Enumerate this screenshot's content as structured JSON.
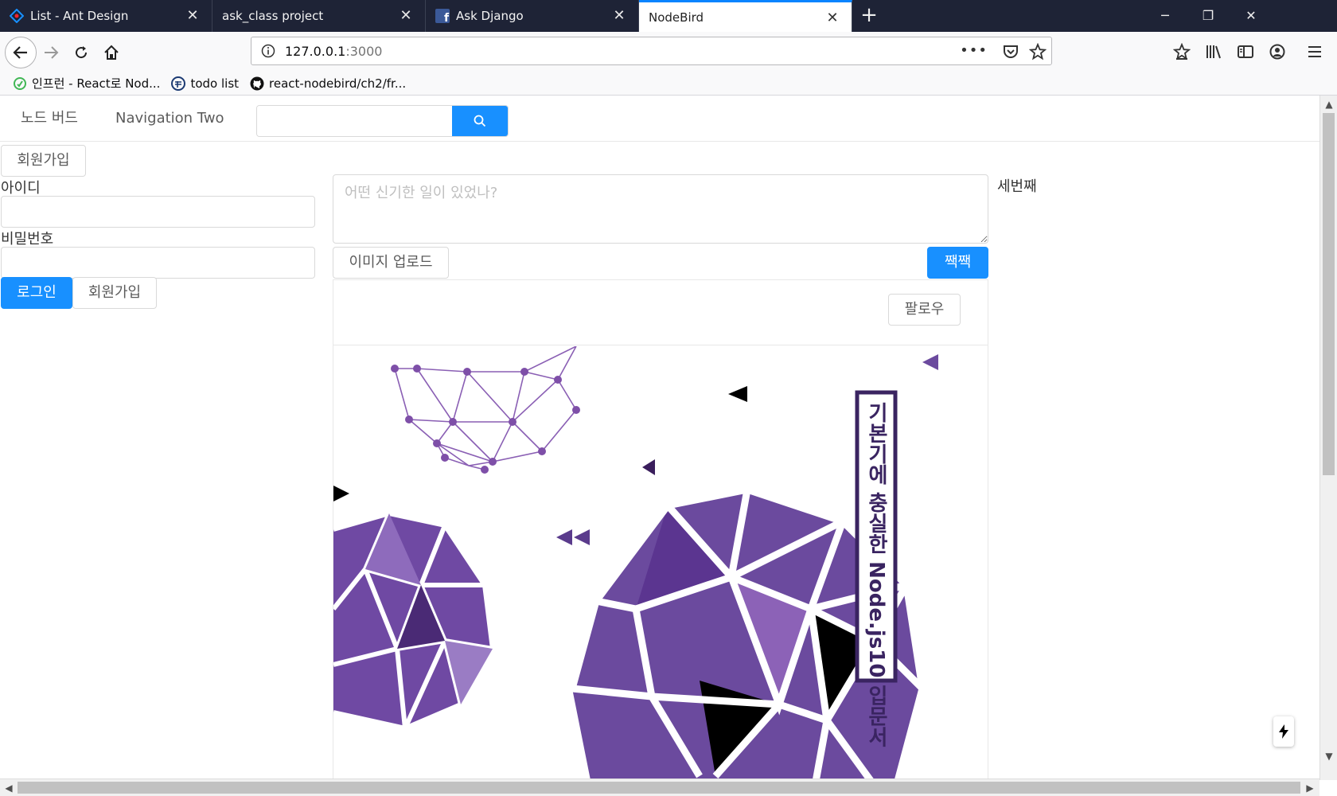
{
  "browser": {
    "tabs": [
      {
        "title": "List - Ant Design",
        "icon": "ant-design-logo-icon"
      },
      {
        "title": "ask_class project",
        "icon": "none"
      },
      {
        "title": "Ask Django",
        "icon": "facebook-icon"
      },
      {
        "title": "NodeBird",
        "icon": "none",
        "active": true
      }
    ],
    "url": {
      "host": "127.0.0.1",
      "port": ":3000"
    },
    "bookmarks": [
      {
        "label": "인프런 - React로 Nod...",
        "icon": "inflearn-icon"
      },
      {
        "label": "todo list",
        "icon": "todo-icon"
      },
      {
        "label": "react-nodebird/ch2/fr...",
        "icon": "github-icon"
      }
    ],
    "colors": {
      "tabbar": "#1e2336",
      "accent": "#0a84ff"
    }
  },
  "menu": {
    "items": [
      "노드 버드",
      "Navigation Two"
    ],
    "search_placeholder": ""
  },
  "left": {
    "signup_top": "회원가입",
    "id_label": "아이디",
    "password_label": "비밀번호",
    "login_button": "로그인",
    "signup_button": "회원가입"
  },
  "post_form": {
    "placeholder": "어떤 신기한 일이 있었나?",
    "upload_button": "이미지 업로드",
    "submit_button": "짹짹"
  },
  "card": {
    "follow_button": "팔로우",
    "cover_text": "기본기에 충실한 Node.js10 입문서"
  },
  "right": {
    "text": "세번째"
  },
  "colors": {
    "primary": "#1890ff",
    "purple": "#6b4a9e"
  }
}
